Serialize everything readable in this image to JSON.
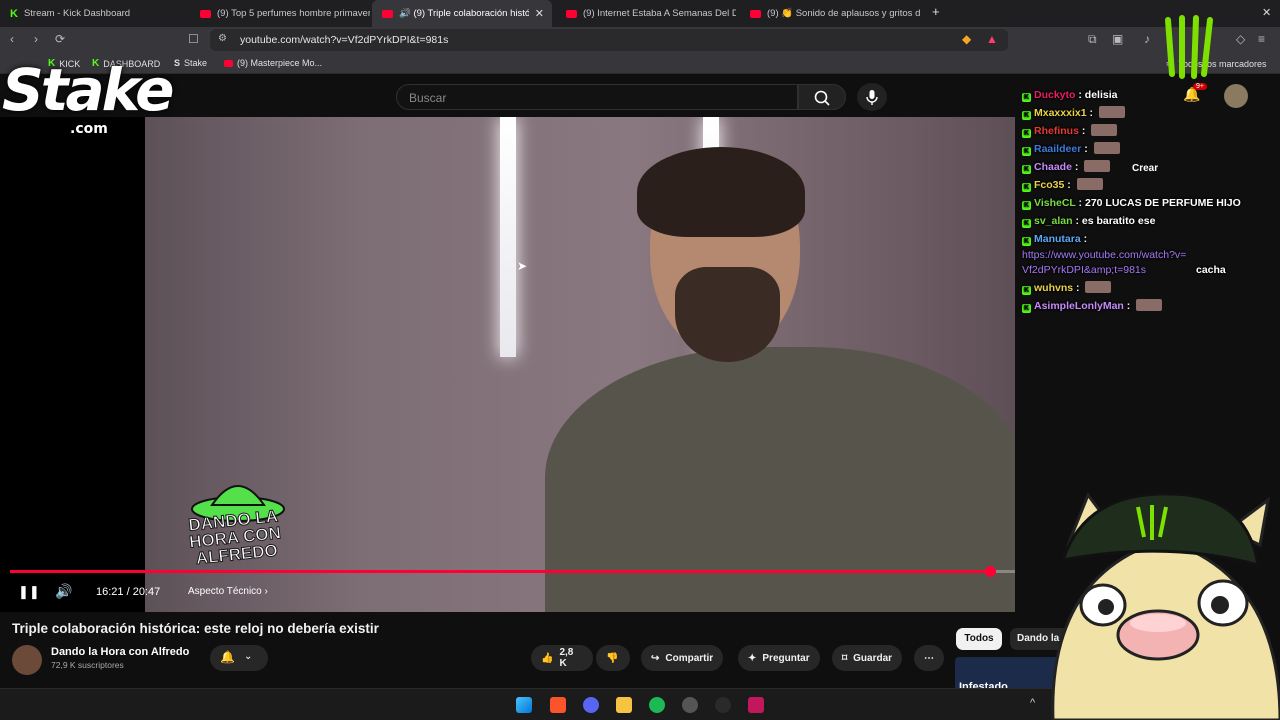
{
  "browser": {
    "tabs": [
      {
        "label": "Stream - Kick Dashboard",
        "type": "kick"
      },
      {
        "label": "(9) Top 5 perfumes hombre primaver",
        "type": "yt"
      },
      {
        "label": "🔊 (9) Triple colaboración históric",
        "type": "yt",
        "active": true
      },
      {
        "label": "(9) Internet Estaba A Semanas Del D",
        "type": "yt"
      },
      {
        "label": "(9) 👏 Sonido de aplausos y gritos d",
        "type": "yt"
      }
    ],
    "new_tab": "+",
    "url": "youtube.com/watch?v=Vf2dPYrkDPI&t=981s",
    "bookmarks": [
      {
        "label": "KICK",
        "icon": "kick"
      },
      {
        "label": "DASHBOARD",
        "icon": "kick"
      },
      {
        "label": "Stake",
        "icon": "stake"
      },
      {
        "label": "(9) Masterpiece Mo...",
        "icon": "yt"
      }
    ],
    "all_bookmarks": "Todos los marcadores"
  },
  "youtube": {
    "search_placeholder": "Buscar",
    "create_label": "Crear",
    "notif_count": "9+",
    "player": {
      "time": "16:21 / 20:47",
      "chapter": "Aspecto Técnico ›",
      "progress": 0.975
    },
    "video_title": "Triple colaboración histórica: este reloj no debería existir",
    "channel": "Dando la Hora con Alfredo",
    "subscribers": "72,9 K suscriptores",
    "likes": "2,8 K",
    "share": "Compartir",
    "ask": "Preguntar",
    "save": "Guardar",
    "filters": [
      "Todos",
      "Dando la"
    ],
    "next_thumb_text": "Infestado",
    "logo_text": "DANDO LA HORA CON ALFREDO"
  },
  "overlay": {
    "stake": "Stake",
    "stake_com": ".com",
    "chat": [
      {
        "user": "Duckyto",
        "color": "#e91e63",
        "text": "delisia"
      },
      {
        "user": "Mxaxxxix1",
        "color": "#e8d34a",
        "text": ""
      },
      {
        "user": "Rhefinus",
        "color": "#e53935",
        "text": ""
      },
      {
        "user": "Raaildeer",
        "color": "#3d7bd8",
        "text": ""
      },
      {
        "user": "Chaade",
        "color": "#c58af9",
        "text": ""
      },
      {
        "user": "Fco35",
        "color": "#e8d34a",
        "text": ""
      },
      {
        "user": "VisheCL",
        "color": "#7bdc45",
        "text": "270 LUCAS DE PERFUME HIJO"
      },
      {
        "user": "sv_alan",
        "color": "#7bdc45",
        "text": "es baratito ese"
      },
      {
        "user": "Manutara",
        "color": "#5aa9f5",
        "text": "",
        "link": "https://www.youtube.com/watch?v=Vf2dPYrkDPI&amp;t=981s",
        "after": "cacha"
      },
      {
        "user": "wuhvns",
        "color": "#e8d34a",
        "text": ""
      },
      {
        "user": "AsimpleLonlyMan",
        "color": "#c58af9",
        "text": ""
      }
    ]
  },
  "colors": {
    "kick_green": "#53fc18",
    "yt_red": "#ff0033",
    "bg": "#0f0f0f"
  }
}
